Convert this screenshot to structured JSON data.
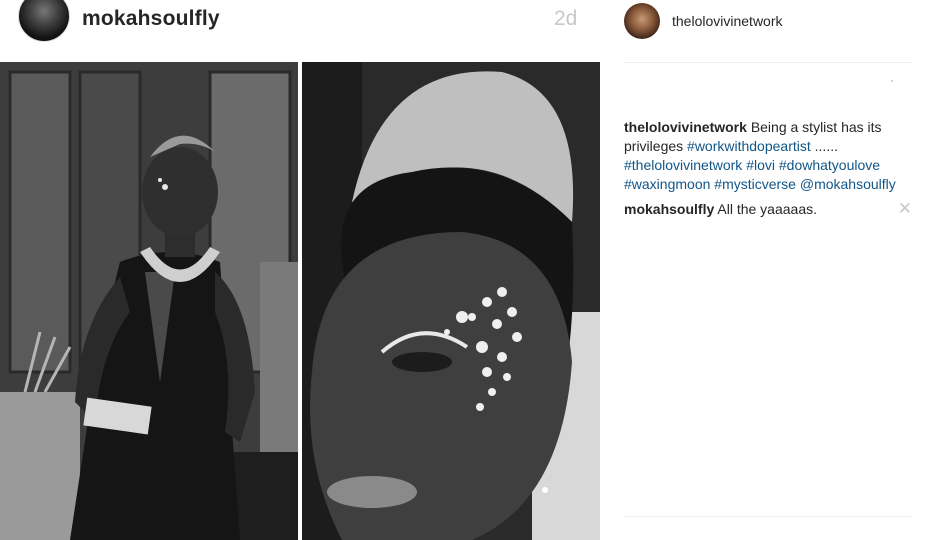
{
  "post": {
    "username": "mokahsoulfly",
    "age": "2d"
  },
  "sidebar": {
    "owner": "thelolovivinetwork",
    "caption": {
      "user": "thelolovivinetwork",
      "text": "Being a stylist has its privileges",
      "tags": [
        "#workwithdopeartist",
        "......",
        "#thelolovivinetwork",
        "#lovi",
        "#dowhatyoulove",
        "#waxingmoon",
        "#mysticverse",
        "@mokahsoulfly"
      ]
    },
    "comment": {
      "user": "mokahsoulfly",
      "text": "All the yaaaaas."
    }
  },
  "icons": {
    "avatar_post": "avatar-image",
    "avatar_owner": "avatar-image",
    "delete_comment": "close-icon"
  },
  "colors": {
    "link": "#125688",
    "text": "#262626",
    "muted": "#c8c8c8"
  }
}
